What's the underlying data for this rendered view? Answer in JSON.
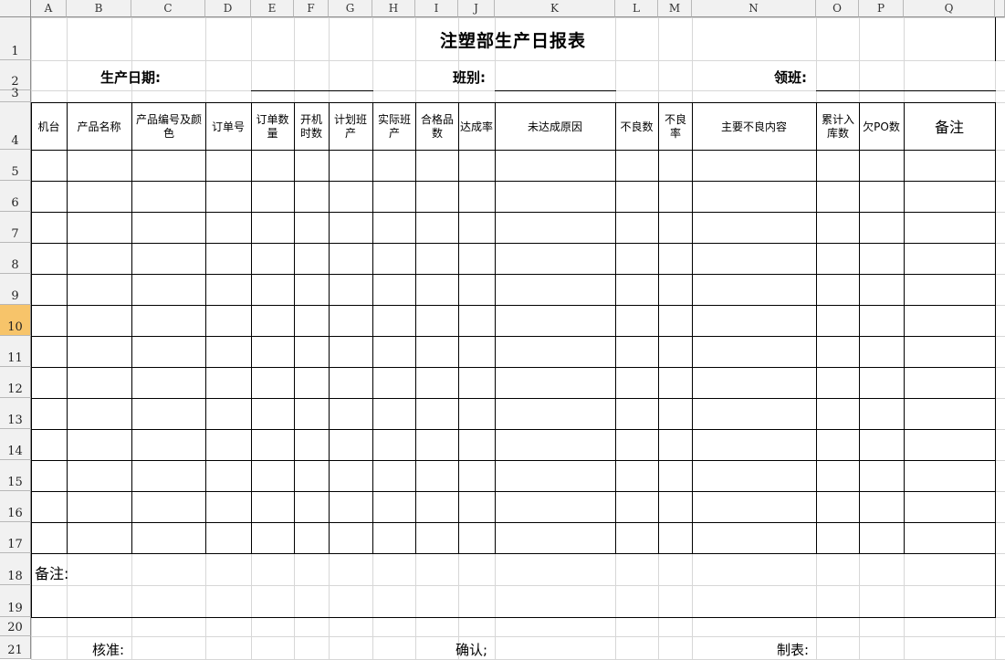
{
  "columns": [
    "A",
    "B",
    "C",
    "D",
    "E",
    "F",
    "G",
    "H",
    "I",
    "J",
    "K",
    "L",
    "M",
    "N",
    "O",
    "P",
    "Q"
  ],
  "rows": [
    "1",
    "2",
    "3",
    "4",
    "5",
    "6",
    "7",
    "8",
    "9",
    "10",
    "11",
    "12",
    "13",
    "14",
    "15",
    "16",
    "17",
    "18",
    "19",
    "20",
    "21"
  ],
  "selected_row": "10",
  "report": {
    "title": "注塑部生产日报表",
    "date_label": "生产日期:",
    "shift_label": "班别:",
    "leader_label": "领班:"
  },
  "table_headers": {
    "machine": "机台",
    "product_name": "产品名称",
    "product_code_color": "产品编号及颜色",
    "order_no": "订单号",
    "order_qty": "订单数量",
    "run_hours": "开机时数",
    "planned_output": "计划班产",
    "actual_output": "实际班产",
    "qualified_qty": "合格品数",
    "achieve_rate": "达成率",
    "reason": "未达成原因",
    "defect_qty": "不良数",
    "defect_rate": "不良率",
    "defect_content": "主要不良内容",
    "cumulative_stock": "累计入库数",
    "po_short": "欠PO数",
    "remarks": "备注"
  },
  "notes_label": "备注:",
  "footer": {
    "approve": "核准:",
    "confirm": "确认;",
    "prepared": "制表:"
  }
}
